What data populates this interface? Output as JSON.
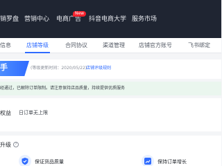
{
  "topnav": {
    "items": [
      "销罗盘",
      "营销中心",
      "电商广告",
      "抖音电商大学",
      "服务市场"
    ],
    "new_badge": "New"
  },
  "tabs": {
    "items": [
      "信息",
      "店铺等级",
      "合同协议",
      "渠道管理",
      "店铺官方账号",
      "飞书绑定"
    ],
    "active_index": 1
  },
  "level": {
    "char": "手",
    "update_time": "(等级更新时间：2020/05/22)",
    "rule_link": "店铺评级规则"
  },
  "notice": {
    "text": "经通过，已解除订单限制。请注意保持店品质量，持续提供优质服务"
  },
  "rights": {
    "title": "权益",
    "subtitle": "日订单无上限"
  },
  "upgrade": {
    "title": "升级",
    "cards": [
      {
        "label": "保证货品质量",
        "icon": "shield-check-icon"
      },
      {
        "label": "保持订单增长",
        "icon": "growth-chart-icon"
      }
    ]
  },
  "colors": {
    "accent": "#2f6bff",
    "nav_bg": "#1f2532",
    "notice_bg": "#eaf6ee"
  }
}
